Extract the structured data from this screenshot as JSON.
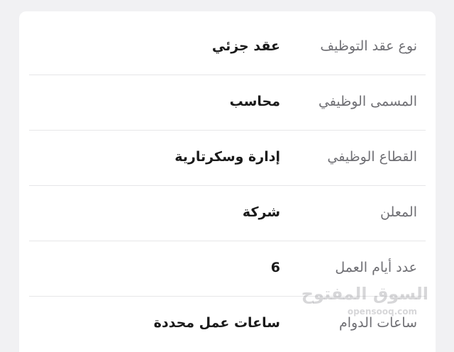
{
  "details": [
    {
      "label": "نوع عقد التوظيف",
      "value": "عقد جزئي"
    },
    {
      "label": "المسمى الوظيفي",
      "value": "محاسب"
    },
    {
      "label": "القطاع الوظيفي",
      "value": "إدارة وسكرتارية"
    },
    {
      "label": "المعلن",
      "value": "شركة"
    },
    {
      "label": "عدد أيام العمل",
      "value": "6"
    },
    {
      "label": "ساعات الدوام",
      "value": "ساعات عمل محددة"
    }
  ],
  "watermark": {
    "arabic": "السوق المفتوح",
    "latin": "opensooq.com"
  },
  "colors": {
    "background": "#f1f1f3",
    "card": "#ffffff",
    "label_text": "#6f6f74",
    "value_text": "#1a1a1a",
    "divider": "#e6e6e8"
  }
}
